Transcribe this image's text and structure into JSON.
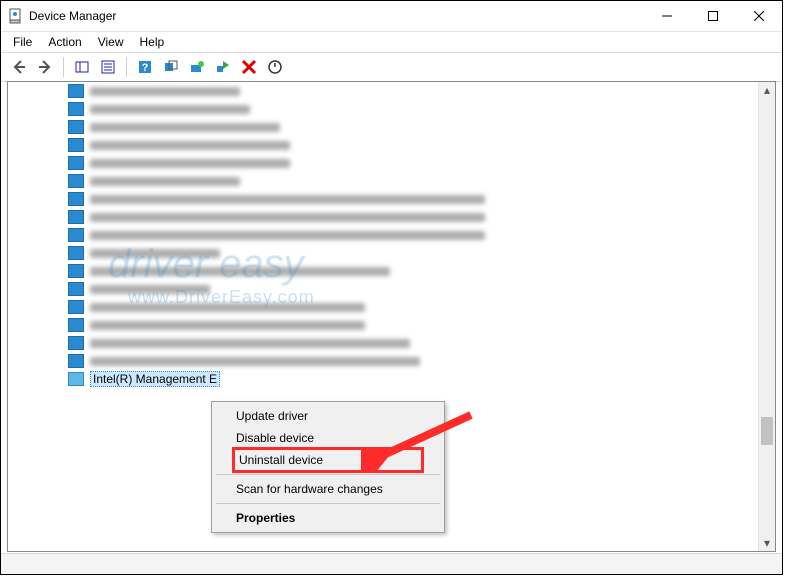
{
  "window": {
    "title": "Device Manager"
  },
  "menus": [
    "File",
    "Action",
    "View",
    "Help"
  ],
  "tree": {
    "selected": "Intel(R) Management E"
  },
  "context_menu": [
    "Update driver",
    "Disable device",
    "Uninstall device",
    "Scan for hardware changes",
    "Properties"
  ],
  "watermark": {
    "line1": "driver easy",
    "line2": "www.DriverEasy.com"
  },
  "annotation": {
    "highlight_color": "#ff2b2b",
    "target": "Uninstall device"
  }
}
